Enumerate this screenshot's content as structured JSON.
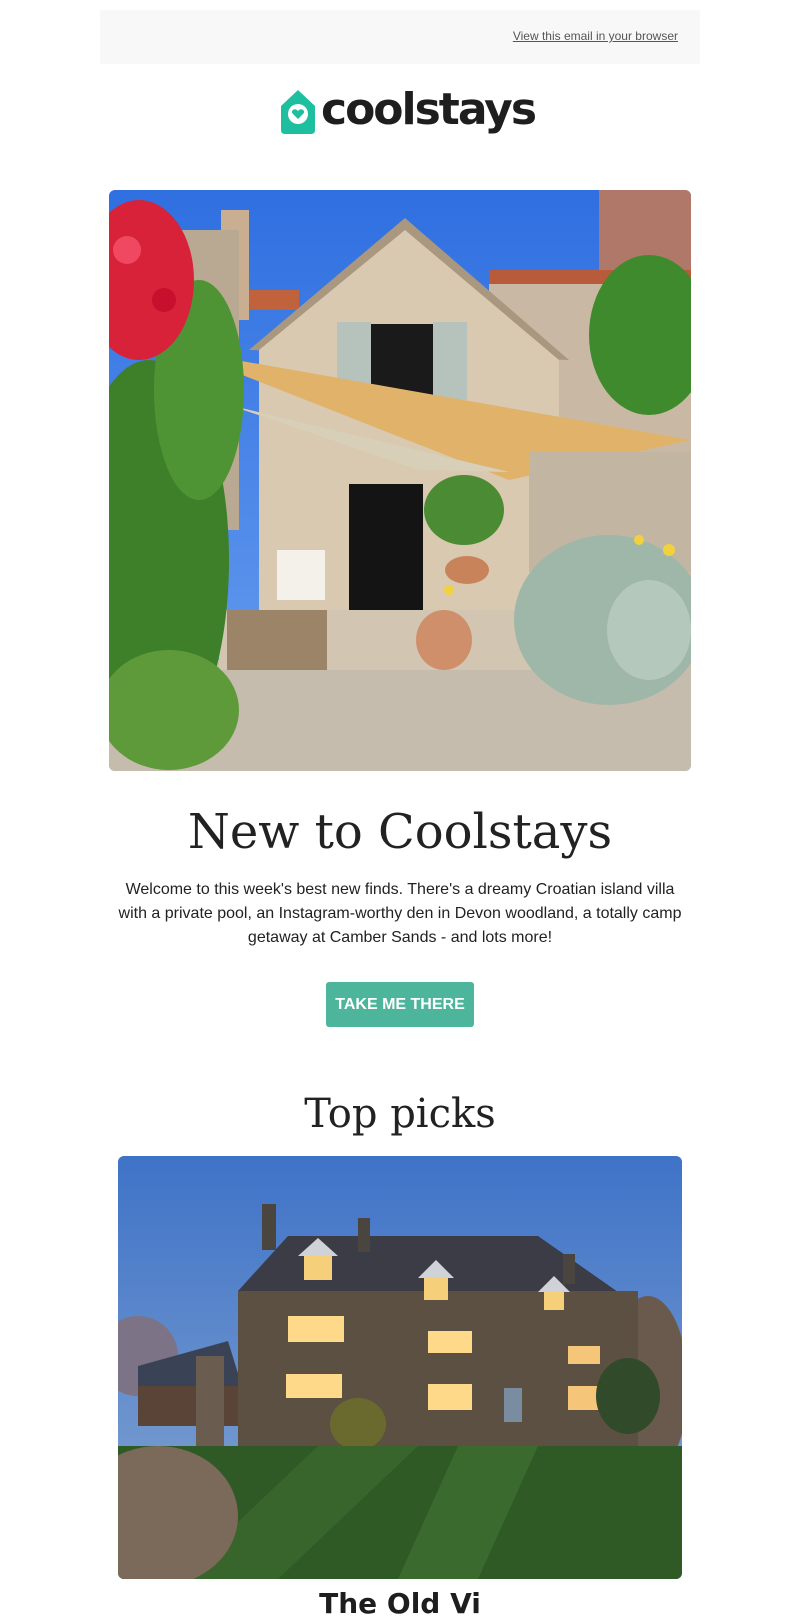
{
  "preheader": {
    "view_in_browser": "View this email in your browser"
  },
  "brand": {
    "name": "coolstays",
    "accent": "#1dbf9f",
    "icon": "house-heart-icon"
  },
  "hero": {
    "image": "stone-cottage-courtyard-photo",
    "title": "New to Coolstays",
    "intro": "Welcome to this week's best new finds. There's a dreamy Croatian island villa with a private pool, an Instagram-worthy den in Devon woodland, a totally camp getaway at Camber Sands - and lots more!",
    "cta_label": "TAKE ME THERE",
    "cta_color": "#4db59b"
  },
  "top_picks": {
    "heading": "Top picks",
    "items": [
      {
        "image": "stone-manor-house-dusk-photo",
        "title": "The Old Vi"
      }
    ]
  }
}
